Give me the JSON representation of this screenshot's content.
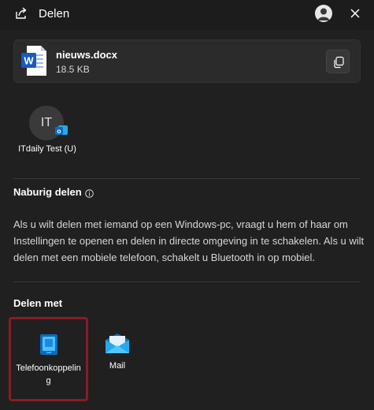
{
  "header": {
    "title": "Delen",
    "share_icon": "share-icon",
    "profile_icon": "profile-avatar-icon",
    "close_icon": "close-icon"
  },
  "file": {
    "name": "nieuws.docx",
    "size": "18.5 KB",
    "icon": "word-document-icon",
    "copy_icon": "copy-icon"
  },
  "contacts": [
    {
      "initials": "IT",
      "name": "ITdaily Test (U)",
      "badge_icon": "outlook-icon"
    }
  ],
  "nearby": {
    "heading": "Naburig delen",
    "info_icon": "info-icon",
    "description": "Als u wilt delen met iemand op een Windows-pc, vraagt u hem of haar om Instellingen te openen en delen in directe omgeving in te schakelen. Als u wilt delen met een mobiele telefoon, schakelt u Bluetooth in op mobiel."
  },
  "share_with": {
    "heading": "Delen met",
    "apps": [
      {
        "label": "Telefoonkoppeling",
        "icon": "phone-link-icon"
      },
      {
        "label": "Mail",
        "icon": "mail-icon"
      }
    ]
  },
  "colors": {
    "background": "#202020",
    "card": "#2b2b2b",
    "highlight_border": "#8b1a26",
    "word_blue": "#185abd",
    "outlook_blue": "#0f6cbd"
  }
}
